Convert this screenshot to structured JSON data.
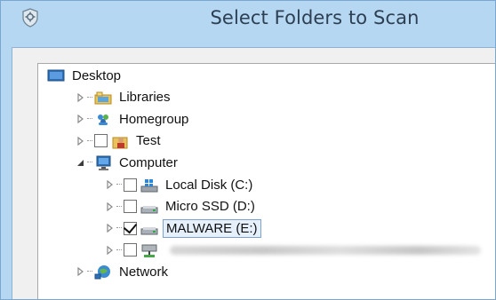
{
  "window": {
    "title": "Select Folders to Scan",
    "icon": "shield-gear-icon"
  },
  "tree": {
    "items": [
      {
        "label": "Desktop",
        "icon": "desktop-icon",
        "level": 0,
        "expander": "none",
        "checkbox": false
      },
      {
        "label": "Libraries",
        "icon": "libraries-icon",
        "level": 1,
        "expander": "collapsed",
        "checkbox": false
      },
      {
        "label": "Homegroup",
        "icon": "homegroup-icon",
        "level": 1,
        "expander": "collapsed",
        "checkbox": false
      },
      {
        "label": "Test",
        "icon": "user-folder-icon",
        "level": 1,
        "expander": "collapsed",
        "checkbox": true,
        "checked": false
      },
      {
        "label": "Computer",
        "icon": "computer-icon",
        "level": 1,
        "expander": "expanded",
        "checkbox": false
      },
      {
        "label": "Local Disk (C:)",
        "icon": "system-drive-icon",
        "level": 2,
        "expander": "collapsed",
        "checkbox": true,
        "checked": false
      },
      {
        "label": "Micro SSD (D:)",
        "icon": "drive-icon",
        "level": 2,
        "expander": "collapsed",
        "checkbox": true,
        "checked": false
      },
      {
        "label": "MALWARE (E:)",
        "icon": "drive-icon",
        "level": 2,
        "expander": "collapsed",
        "checkbox": true,
        "checked": true,
        "selected": true
      },
      {
        "label": "",
        "icon": "network-drive-icon",
        "level": 2,
        "expander": "collapsed",
        "checkbox": true,
        "checked": false,
        "redacted": true
      },
      {
        "label": "Network",
        "icon": "network-icon",
        "level": 1,
        "expander": "collapsed",
        "checkbox": false
      }
    ]
  },
  "colors": {
    "window_frame": "#b6d7f1",
    "selection_border": "#7da2ce",
    "selection_fill": "#e6f0fb"
  }
}
